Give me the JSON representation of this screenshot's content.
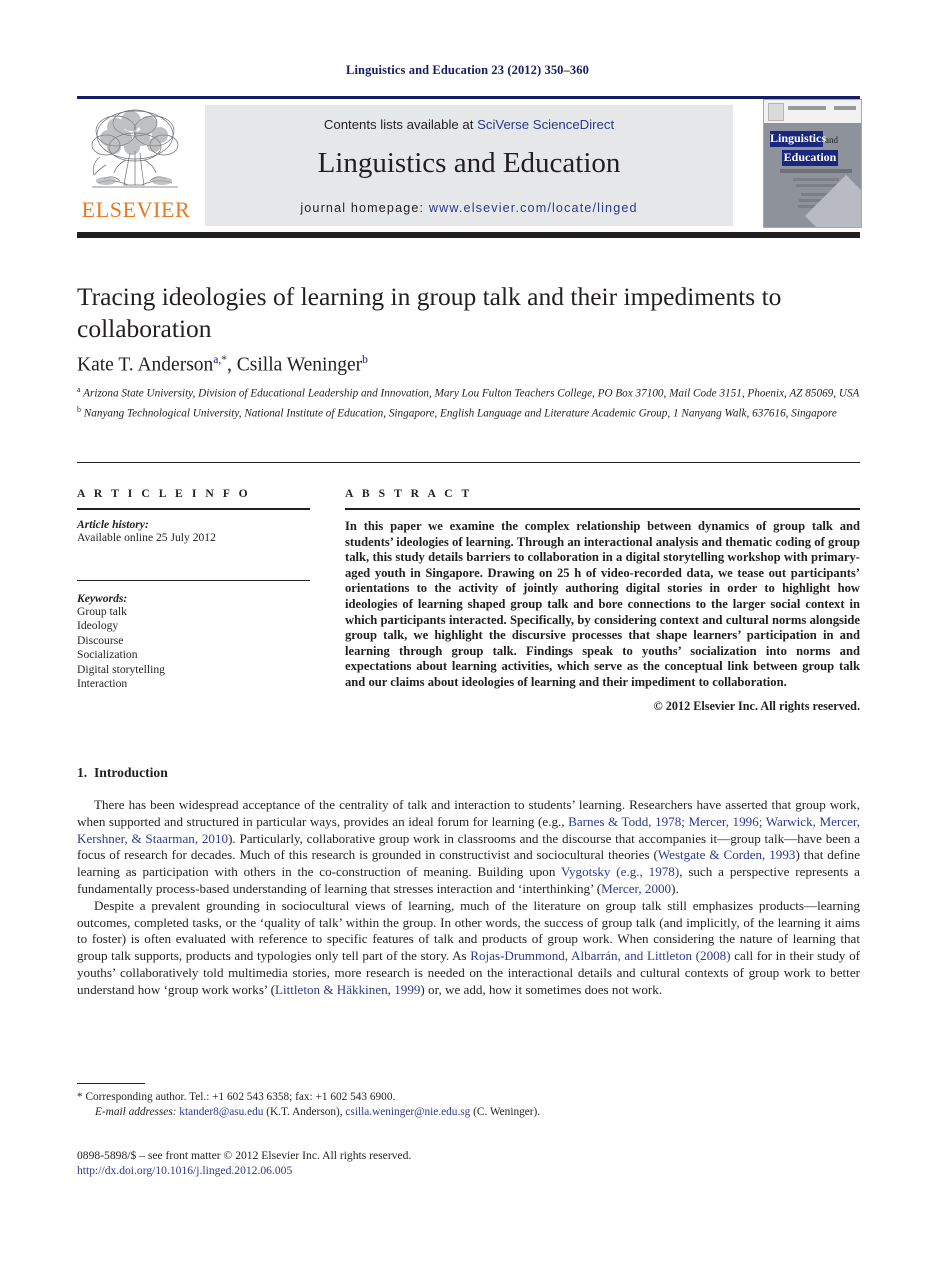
{
  "running_head": "Linguistics and Education 23 (2012) 350–360",
  "header": {
    "contents_prefix": "Contents lists available at ",
    "contents_link": "SciVerse ScienceDirect",
    "journal_name": "Linguistics and Education",
    "homepage_prefix": "journal homepage: ",
    "homepage_link": "www.elsevier.com/locate/linged",
    "publisher_wordmark": "ELSEVIER",
    "link_color": "#2b3a8f",
    "rule_color": "#151b64"
  },
  "cover": {
    "line1": "Linguistics",
    "line1_and": "and",
    "line2": "Education",
    "subtitle": "AN INTERNATIONAL RESEARCH JOURNAL"
  },
  "article": {
    "title": "Tracing ideologies of learning in group talk and their impediments to collaboration",
    "authors_html": "Kate T. Anderson<sup>a,*</sup>, Csilla Weninger<sup>b</sup>",
    "affiliations": [
      {
        "marker": "a",
        "text": "Arizona State University, Division of Educational Leadership and Innovation, Mary Lou Fulton Teachers College, PO Box 37100, Mail Code 3151, Phoenix, AZ 85069, USA"
      },
      {
        "marker": "b",
        "text": "Nanyang Technological University, National Institute of Education, Singapore, English Language and Literature Academic Group, 1 Nanyang Walk, 637616, Singapore"
      }
    ]
  },
  "info": {
    "heading": "A R T I C L E    I N F O",
    "history_label": "Article history:",
    "history_value": "Available online 25 July 2012",
    "keywords_label": "Keywords:",
    "keywords": [
      "Group talk",
      "Ideology",
      "Discourse",
      "Socialization",
      "Digital storytelling",
      "Interaction"
    ]
  },
  "abstract": {
    "heading": "A B S T R A C T",
    "text": "In this paper we examine the complex relationship between dynamics of group talk and students’ ideologies of learning. Through an interactional analysis and thematic coding of group talk, this study details barriers to collaboration in a digital storytelling workshop with primary-aged youth in Singapore. Drawing on 25 h of video-recorded data, we tease out participants’ orientations to the activity of jointly authoring digital stories in order to highlight how ideologies of learning shaped group talk and bore connections to the larger social context in which participants interacted. Specifically, by considering context and cultural norms alongside group talk, we highlight the discursive processes that shape learners’ participation in and learning through group talk. Findings speak to youths’ socialization into norms and expectations about learning activities, which serve as the conceptual link between group talk and our claims about ideologies of learning and their impediment to collaboration.",
    "copyright": "© 2012 Elsevier Inc. All rights reserved."
  },
  "body": {
    "section_number": "1.",
    "section_title": "Introduction",
    "paragraph1": [
      {
        "t": "There has been widespread acceptance of the centrality of talk and interaction to students’ learning. Researchers have asserted that group work, when supported and structured in particular ways, provides an ideal forum for learning (e.g., "
      },
      {
        "t": "Barnes & Todd, 1978; Mercer, 1996; Warwick, Mercer, Kershner, & Staarman, 2010",
        "link": true
      },
      {
        "t": "). Particularly, collaborative group work in classrooms and the discourse that accompanies it—group talk—have been a focus of research for decades. Much of this research is grounded in constructivist and sociocultural theories ("
      },
      {
        "t": "Westgate & Corden, 1993",
        "link": true
      },
      {
        "t": ") that define learning as participation with others in the co-construction of meaning. Building upon "
      },
      {
        "t": "Vygotsky (e.g., 1978)",
        "link": true
      },
      {
        "t": ", such a perspective represents a fundamentally process-based understanding of learning that stresses interaction and ‘interthinking’ ("
      },
      {
        "t": "Mercer, 2000",
        "link": true
      },
      {
        "t": ")."
      }
    ],
    "paragraph2": [
      {
        "t": "Despite a prevalent grounding in sociocultural views of learning, much of the literature on group talk still emphasizes products—learning outcomes, completed tasks, or the ‘quality of talk’ within the group. In other words, the success of group talk (and implicitly, of the learning it aims to foster) is often evaluated with reference to specific features of talk and products of group work. When considering the nature of learning that group talk supports, products and typologies only tell part of the story. As "
      },
      {
        "t": "Rojas-Drummond, Albarrán, and Littleton (2008)",
        "link": true
      },
      {
        "t": " call for in their study of youths’ collaboratively told multimedia stories, more research is needed on the interactional details and cultural contexts of group work to better understand how ‘group work works’ ("
      },
      {
        "t": "Littleton & Häkkinen, 1999",
        "link": true
      },
      {
        "t": ") or, we add, how it sometimes does not work."
      }
    ]
  },
  "footnotes": {
    "corresponding": "*   Corresponding author. Tel.: +1 602 543 6358; fax: +1 602 543 6900.",
    "email_label": "E-mail addresses:",
    "email1": "ktander8@asu.edu",
    "email1_owner": "(K.T. Anderson),",
    "email2": "csilla.weninger@nie.edu.sg",
    "email2_owner": "(C. Weninger)."
  },
  "imprint": {
    "issn_line": "0898-5898/$ – see front matter © 2012 Elsevier Inc. All rights reserved.",
    "doi": "http://dx.doi.org/10.1016/j.linged.2012.06.005"
  }
}
